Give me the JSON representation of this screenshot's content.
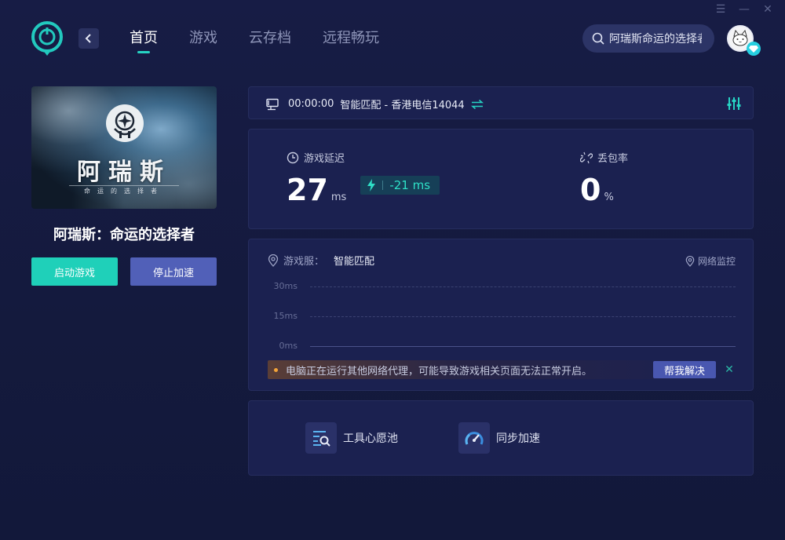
{
  "window": {
    "controls": [
      "☰",
      "—",
      "✕"
    ]
  },
  "nav": {
    "items": [
      {
        "label": "首页",
        "active": true
      },
      {
        "label": "游戏",
        "active": false
      },
      {
        "label": "云存档",
        "active": false
      },
      {
        "label": "远程畅玩",
        "active": false
      }
    ]
  },
  "search": {
    "value": "阿瑞斯命运的选择者"
  },
  "game": {
    "cover_title": "阿瑞斯",
    "cover_subtitle": "命运的选择者",
    "name": "阿瑞斯：命运的选择者",
    "start_label": "启动游戏",
    "stop_label": "停止加速"
  },
  "status": {
    "time": "00:00:00",
    "route": "智能匹配 - 香港电信14044"
  },
  "metrics": {
    "latency_label": "游戏延迟",
    "latency_value": "27",
    "latency_unit": "ms",
    "latency_delta": "-21 ms",
    "loss_label": "丢包率",
    "loss_value": "0",
    "loss_unit": "%"
  },
  "server": {
    "label": "游戏服：",
    "value": "智能匹配",
    "monitor_label": "网络监控"
  },
  "chart_data": {
    "type": "line",
    "title": "",
    "xlabel": "",
    "ylabel": "",
    "yticks": [
      "30ms",
      "15ms",
      "0ms"
    ],
    "ylim": [
      0,
      30
    ],
    "grid": true,
    "series": [
      {
        "values": []
      }
    ]
  },
  "warning": {
    "text": "电脑正在运行其他网络代理，可能导致游戏相关页面无法正常开启。",
    "help_label": "帮我解决",
    "close": "✕"
  },
  "tools": [
    {
      "label": "工具心愿池",
      "icon": "wishlist-search-icon"
    },
    {
      "label": "同步加速",
      "icon": "speedometer-icon"
    }
  ],
  "colors": {
    "accent": "#26d3c3",
    "start_button": "#1fd0b9",
    "stop_button": "#5160b8",
    "warning_dot": "#f3a43a"
  }
}
